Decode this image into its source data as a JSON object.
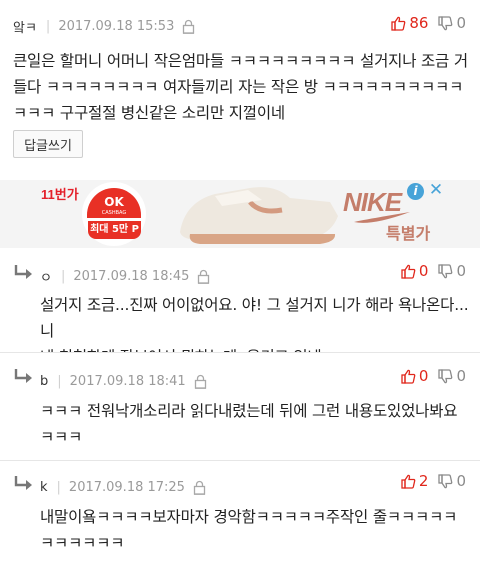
{
  "comments": [
    {
      "author": "앜ㅋ",
      "date": "2017.09.18 15:53",
      "up": "86",
      "down": "0",
      "text_lines": [
        "큰일은 할머니 어머니 작은엄마들 ㅋㅋㅋㅋㅋㅋㅋㅋㅋ 설거지나 조금 거",
        "들다 ㅋㅋㅋㅋㅋㅋㅋㅋ 여자들끼리 자는 작은 방 ㅋㅋㅋㅋㅋㅋㅋㅋㅋㅋ",
        "ㅋㅋㅋ 구구절절 병신같은 소리만 지껄이네"
      ],
      "reply_button": "답글쓰기"
    },
    {
      "author": "ㅇ",
      "date": "2017.09.18 18:45",
      "up": "0",
      "down": "0",
      "text_lines": [
        "설거지 조금...진짜 어이없어요. 야! 그 설거지 니가 해라 욕나온다...니",
        "네 친척한테 잘보여서 뭐하는데. 웃기고 있네"
      ]
    },
    {
      "author": "b",
      "date": "2017.09.18 18:41",
      "up": "0",
      "down": "0",
      "text_lines": [
        "ㅋㅋㅋ 전워낙개소리라 읽다내렸는데 뒤에 그런 내용도있었나봐요",
        "ㅋㅋㅋ"
      ]
    },
    {
      "author": "k",
      "date": "2017.09.18 17:25",
      "up": "2",
      "down": "0",
      "text_lines": [
        "내말이욬ㅋㅋㅋㅋ보자마자 경악함ㅋㅋㅋㅋㅋ주작인 줄ㅋㅋㅋㅋㅋ",
        "ㅋㅋㅋㅋㅋㅋ"
      ]
    }
  ],
  "ad": {
    "store": "11번가",
    "ok_top": "OK",
    "ok_sub": "CASHBAG",
    "ok_points": "최대 5만 P",
    "brand": "NIKE",
    "promo": "특별가",
    "info_icon": "info-icon",
    "close_icon": "close-icon"
  },
  "colors": {
    "upvote": "#e0271c",
    "downvote": "#8a8a8a",
    "meta": "#9a9a9a"
  }
}
